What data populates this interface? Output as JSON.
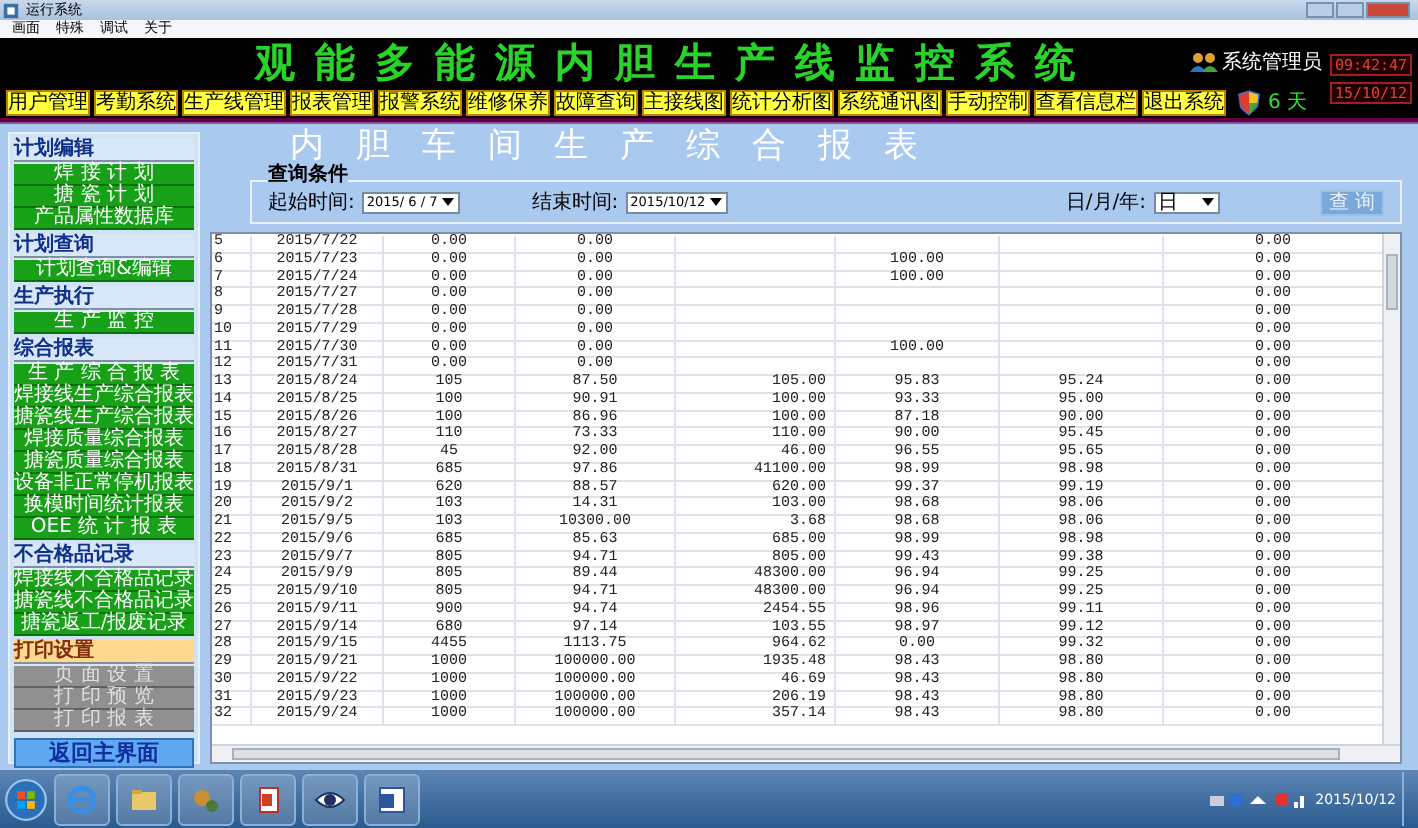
{
  "window": {
    "title": "运行系统"
  },
  "menu": [
    "画面",
    "特殊",
    "调试",
    "关于"
  ],
  "header": {
    "title": "观能多能源内胆生产线监控系统",
    "user": "系统管理员",
    "days": "6 天",
    "time": "09:42:47",
    "date": "15/10/12"
  },
  "nav": [
    "用户管理",
    "考勤系统",
    "生产线管理",
    "报表管理",
    "报警系统",
    "维修保养",
    "故障查询",
    "主接线图",
    "统计分析图",
    "系统通讯图",
    "手动控制",
    "查看信息栏",
    "退出系统"
  ],
  "report_title": "内胆车间生产综合报表",
  "query": {
    "title": "查询条件",
    "start_label": "起始时间:",
    "start_value": "2015/ 6 / 7",
    "end_label": "结束时间:",
    "end_value": "2015/10/12",
    "period_label": "日/月/年:",
    "period_value": "日",
    "button": "查 询"
  },
  "sidebar": [
    {
      "title": "计划编辑",
      "kind": "menu",
      "items": [
        {
          "label": "焊 接 计 划",
          "disabled": false
        },
        {
          "label": "搪 瓷 计 划",
          "disabled": false
        },
        {
          "label": "产品属性数据库",
          "disabled": false
        }
      ]
    },
    {
      "title": "计划查询",
      "kind": "menu",
      "items": [
        {
          "label": "计划查询&编辑",
          "disabled": false
        }
      ]
    },
    {
      "title": "生产执行",
      "kind": "menu",
      "items": [
        {
          "label": "生 产 监 控",
          "disabled": false
        }
      ]
    },
    {
      "title": "综合报表",
      "kind": "menu",
      "items": [
        {
          "label": "生 产 综 合 报 表",
          "disabled": false
        },
        {
          "label": "焊接线生产综合报表",
          "disabled": false
        },
        {
          "label": "搪瓷线生产综合报表",
          "disabled": false
        },
        {
          "label": "焊接质量综合报表",
          "disabled": false
        },
        {
          "label": "搪瓷质量综合报表",
          "disabled": false
        },
        {
          "label": "设备非正常停机报表",
          "disabled": false
        },
        {
          "label": "换模时间统计报表",
          "disabled": false
        },
        {
          "label": "OEE 统 计 报 表",
          "disabled": false
        }
      ]
    },
    {
      "title": "不合格品记录",
      "kind": "menu",
      "items": [
        {
          "label": "焊接线不合格品记录",
          "disabled": false
        },
        {
          "label": "搪瓷线不合格品记录",
          "disabled": false
        },
        {
          "label": "搪瓷返工/报废记录",
          "disabled": false
        }
      ]
    },
    {
      "title": "打印设置",
      "kind": "print",
      "items": [
        {
          "label": "页 面 设 置",
          "disabled": true
        },
        {
          "label": "打 印 预 览",
          "disabled": true
        },
        {
          "label": "打 印 报 表",
          "disabled": true
        }
      ]
    }
  ],
  "return_button": "返回主界面",
  "table": {
    "rows": [
      [
        "5",
        "2015/7/22",
        "0.00",
        "0.00",
        null,
        null,
        null,
        "0.00"
      ],
      [
        "6",
        "2015/7/23",
        "0.00",
        "0.00",
        null,
        "100.00",
        null,
        "0.00"
      ],
      [
        "7",
        "2015/7/24",
        "0.00",
        "0.00",
        null,
        "100.00",
        null,
        "0.00"
      ],
      [
        "8",
        "2015/7/27",
        "0.00",
        "0.00",
        null,
        null,
        null,
        "0.00"
      ],
      [
        "9",
        "2015/7/28",
        "0.00",
        "0.00",
        null,
        null,
        null,
        "0.00"
      ],
      [
        "10",
        "2015/7/29",
        "0.00",
        "0.00",
        null,
        null,
        null,
        "0.00"
      ],
      [
        "11",
        "2015/7/30",
        "0.00",
        "0.00",
        null,
        "100.00",
        null,
        "0.00"
      ],
      [
        "12",
        "2015/7/31",
        "0.00",
        "0.00",
        null,
        null,
        null,
        "0.00"
      ],
      [
        "13",
        "2015/8/24",
        "105",
        "87.50",
        "105.00",
        "95.83",
        "95.24",
        "0.00"
      ],
      [
        "14",
        "2015/8/25",
        "100",
        "90.91",
        "100.00",
        "93.33",
        "95.00",
        "0.00"
      ],
      [
        "15",
        "2015/8/26",
        "100",
        "86.96",
        "100.00",
        "87.18",
        "90.00",
        "0.00"
      ],
      [
        "16",
        "2015/8/27",
        "110",
        "73.33",
        "110.00",
        "90.00",
        "95.45",
        "0.00"
      ],
      [
        "17",
        "2015/8/28",
        "45",
        "92.00",
        "46.00",
        "96.55",
        "95.65",
        "0.00"
      ],
      [
        "18",
        "2015/8/31",
        "685",
        "97.86",
        "41100.00",
        "98.99",
        "98.98",
        "0.00"
      ],
      [
        "19",
        "2015/9/1",
        "620",
        "88.57",
        "620.00",
        "99.37",
        "99.19",
        "0.00"
      ],
      [
        "20",
        "2015/9/2",
        "103",
        "14.31",
        "103.00",
        "98.68",
        "98.06",
        "0.00"
      ],
      [
        "21",
        "2015/9/5",
        "103",
        "10300.00",
        "3.68",
        "98.68",
        "98.06",
        "0.00"
      ],
      [
        "22",
        "2015/9/6",
        "685",
        "85.63",
        "685.00",
        "98.99",
        "98.98",
        "0.00"
      ],
      [
        "23",
        "2015/9/7",
        "805",
        "94.71",
        "805.00",
        "99.43",
        "99.38",
        "0.00"
      ],
      [
        "24",
        "2015/9/9",
        "805",
        "89.44",
        "48300.00",
        "96.94",
        "99.25",
        "0.00"
      ],
      [
        "25",
        "2015/9/10",
        "805",
        "94.71",
        "48300.00",
        "96.94",
        "99.25",
        "0.00"
      ],
      [
        "26",
        "2015/9/11",
        "900",
        "94.74",
        "2454.55",
        "98.96",
        "99.11",
        "0.00"
      ],
      [
        "27",
        "2015/9/14",
        "680",
        "97.14",
        "103.55",
        "98.97",
        "99.12",
        "0.00"
      ],
      [
        "28",
        "2015/9/15",
        "4455",
        "1113.75",
        "964.62",
        "0.00",
        "99.32",
        "0.00"
      ],
      [
        "29",
        "2015/9/21",
        "1000",
        "100000.00",
        "1935.48",
        "98.43",
        "98.80",
        "0.00"
      ],
      [
        "30",
        "2015/9/22",
        "1000",
        "100000.00",
        "46.69",
        "98.43",
        "98.80",
        "0.00"
      ],
      [
        "31",
        "2015/9/23",
        "1000",
        "100000.00",
        "206.19",
        "98.43",
        "98.80",
        "0.00"
      ],
      [
        "32",
        "2015/9/24",
        "1000",
        "100000.00",
        "357.14",
        "98.43",
        "98.80",
        "0.00"
      ]
    ]
  },
  "taskbar": {
    "date": "2015/10/12"
  }
}
